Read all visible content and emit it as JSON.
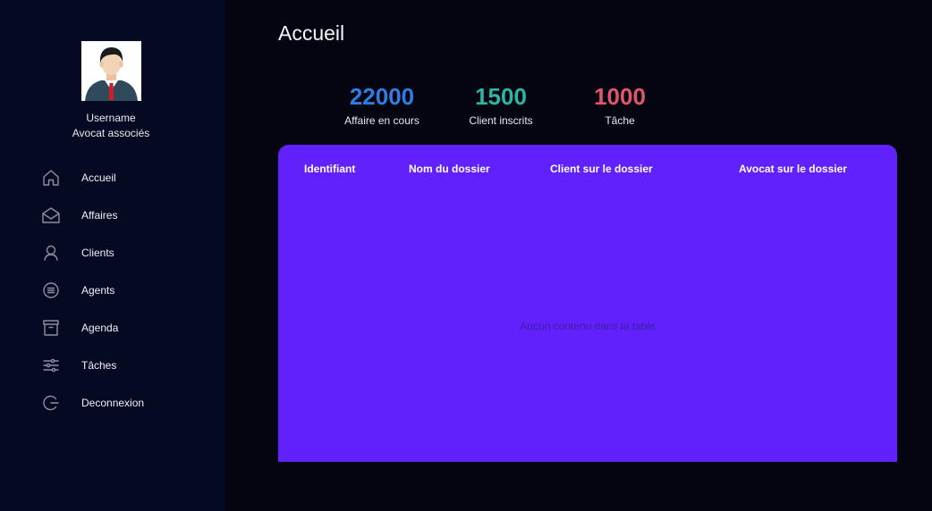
{
  "user": {
    "name": "Username",
    "role": "Avocat associés"
  },
  "nav": {
    "items": [
      {
        "label": "Accueil",
        "icon": "home-icon"
      },
      {
        "label": "Affaires",
        "icon": "mail-open-icon"
      },
      {
        "label": "Clients",
        "icon": "user-icon"
      },
      {
        "label": "Agents",
        "icon": "list-circle-icon"
      },
      {
        "label": "Agenda",
        "icon": "archive-icon"
      },
      {
        "label": "Tâches",
        "icon": "sliders-icon"
      },
      {
        "label": "Deconnexion",
        "icon": "logout-icon"
      }
    ]
  },
  "page": {
    "title": "Accueil"
  },
  "stats": [
    {
      "value": "22000",
      "label": "Affaire en cours",
      "color": "#2f7de1"
    },
    {
      "value": "1500",
      "label": "Client inscrits",
      "color": "#2cb5a0"
    },
    {
      "value": "1000",
      "label": "Tâche",
      "color": "#e0566b"
    }
  ],
  "table": {
    "columns": [
      "Identifiant",
      "Nom du dossier",
      "Client sur le dossier",
      "Avocat sur le dossier"
    ],
    "empty_message": "Aucun contenu dans la table",
    "background": "#6121fd"
  }
}
